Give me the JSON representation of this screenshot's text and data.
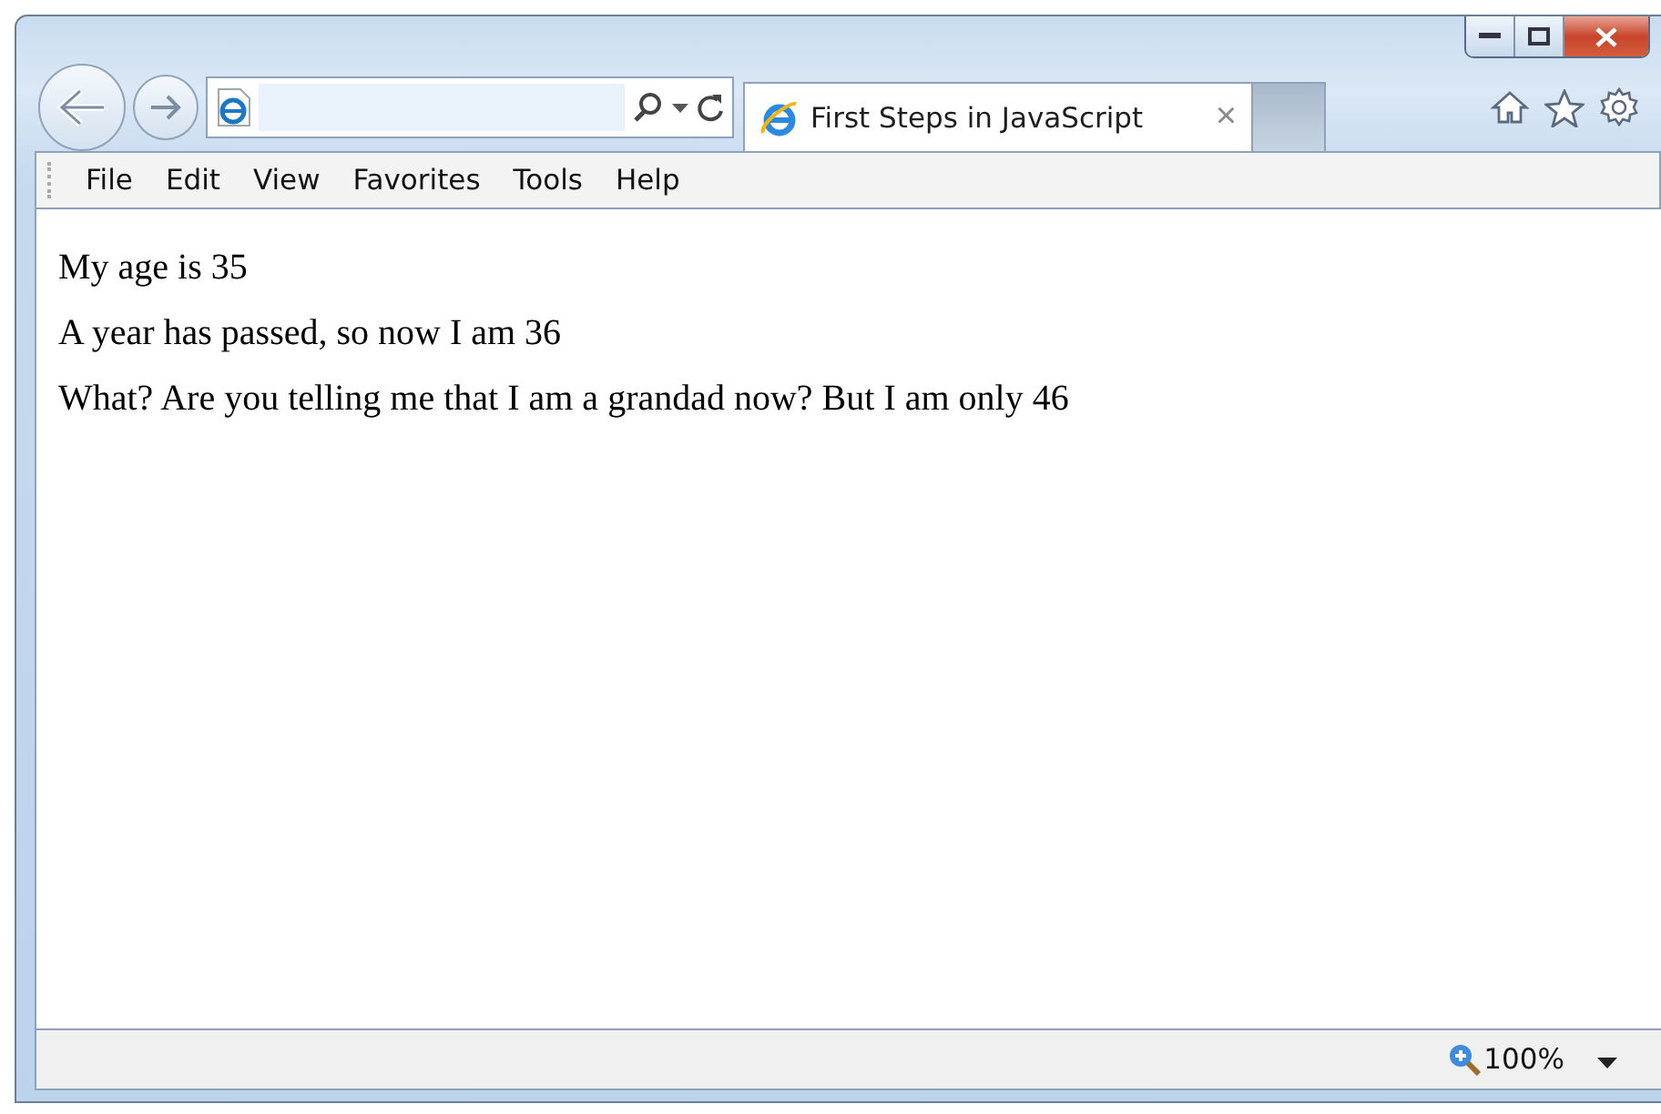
{
  "tab": {
    "title": "First Steps in JavaScript",
    "close": "×"
  },
  "menu": [
    {
      "label": "File"
    },
    {
      "label": "Edit"
    },
    {
      "label": "View"
    },
    {
      "label": "Favorites"
    },
    {
      "label": "Tools"
    },
    {
      "label": "Help"
    }
  ],
  "content": {
    "paragraphs": [
      "My age is 35",
      "A year has passed, so now I am 36",
      "What? Are you telling me that I am a grandad now? But I am only 46"
    ]
  },
  "status_bar": {
    "zoom": "100%"
  }
}
